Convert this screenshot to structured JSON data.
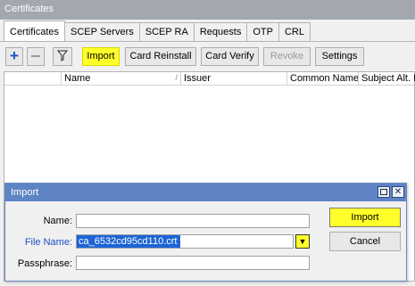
{
  "window": {
    "title": "Certificates"
  },
  "tabs": [
    "Certificates",
    "SCEP Servers",
    "SCEP RA",
    "Requests",
    "OTP",
    "CRL"
  ],
  "toolbar": {
    "add_icon": "plus-icon",
    "remove_icon": "minus-icon",
    "filter_icon": "filter-funnel-icon",
    "import_label": "Import",
    "card_reinstall_label": "Card Reinstall",
    "card_verify_label": "Card Verify",
    "revoke_label": "Revoke",
    "settings_label": "Settings",
    "highlight_color": "#ffff2a"
  },
  "table": {
    "columns": [
      "",
      "Name",
      "Issuer",
      "Common Name",
      "Subject Alt. N"
    ],
    "rows": []
  },
  "dialog": {
    "title": "Import",
    "maximize_icon": "maximize-icon",
    "close_icon": "close-icon",
    "name_label": "Name:",
    "name_value": "",
    "file_name_label": "File Name:",
    "file_name_value": "ca_6532cd95cd110.crt",
    "dropdown_icon": "dropdown-arrow-icon",
    "passphrase_label": "Passphrase:",
    "passphrase_value": "",
    "import_label": "Import",
    "cancel_label": "Cancel",
    "title_color": "#5e84c6",
    "selection_color": "#1c64d6"
  }
}
